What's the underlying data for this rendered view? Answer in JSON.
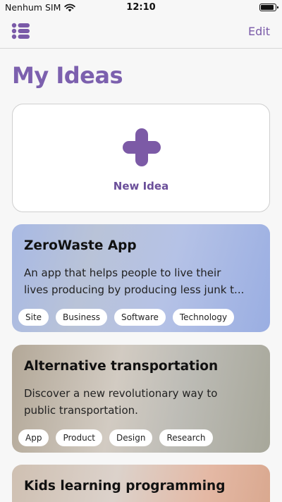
{
  "status_bar": {
    "carrier": "Nenhum SIM",
    "time": "12:10"
  },
  "nav": {
    "menu_icon": "list-icon",
    "edit_label": "Edit"
  },
  "page_title": "My Ideas",
  "new_idea": {
    "icon": "plus-icon",
    "label": "New Idea"
  },
  "ideas": [
    {
      "title": "ZeroWaste App",
      "description_lines": [
        "An app that helps people to live their",
        "lives producing by producing less junk t..."
      ],
      "tags": [
        "Site",
        "Business",
        "Software",
        "Technology"
      ]
    },
    {
      "title": "Alternative transportation",
      "description_lines": [
        "Discover a new revolutionary way to",
        "public transportation."
      ],
      "tags": [
        "App",
        "Product",
        "Design",
        "Research"
      ]
    },
    {
      "title": "Kids learning programming",
      "description_lines": [],
      "tags": []
    }
  ],
  "colors": {
    "accent": "#7c60ae",
    "accent_dark": "#6b4f9a"
  }
}
